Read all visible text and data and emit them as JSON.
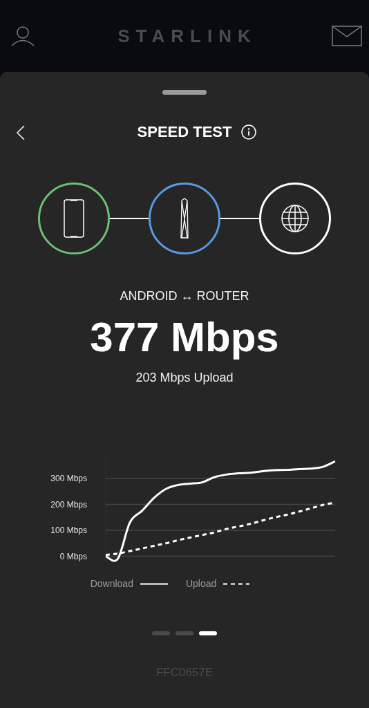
{
  "header": {
    "logo": "STARLINK"
  },
  "sheet": {
    "title": "SPEED TEST",
    "nodes": [
      {
        "kind": "phone",
        "color": "#6cc070"
      },
      {
        "kind": "router",
        "color": "#5a9ae0"
      },
      {
        "kind": "globe",
        "color": "#ffffff"
      }
    ],
    "link_label": "ANDROID ↔ ROUTER",
    "download_speed": "377 Mbps",
    "upload_speed": "203 Mbps Upload",
    "chart_data": {
      "type": "line",
      "grid": true,
      "ylim": [
        -20,
        380
      ],
      "yticks": [
        {
          "value": 0,
          "label": "0 Mbps"
        },
        {
          "value": 100,
          "label": "100 Mbps"
        },
        {
          "value": 200,
          "label": "200 Mbps"
        },
        {
          "value": 300,
          "label": "300 Mbps"
        }
      ],
      "series": [
        {
          "name": "Download",
          "color": "#ffffff",
          "line_style": "solid",
          "values": [
            0,
            -10,
            130,
            175,
            225,
            260,
            275,
            280,
            285,
            305,
            315,
            320,
            322,
            328,
            332,
            333,
            336,
            338,
            345,
            366
          ]
        },
        {
          "name": "Upload",
          "color": "#ffffff",
          "line_style": "dashed",
          "values": [
            5,
            10,
            20,
            30,
            40,
            50,
            62,
            72,
            82,
            92,
            105,
            115,
            125,
            138,
            150,
            160,
            172,
            185,
            198,
            207
          ]
        }
      ]
    },
    "pages": [
      {
        "selected": false
      },
      {
        "selected": false
      },
      {
        "selected": true
      }
    ],
    "device_id": "FFC0657E"
  }
}
